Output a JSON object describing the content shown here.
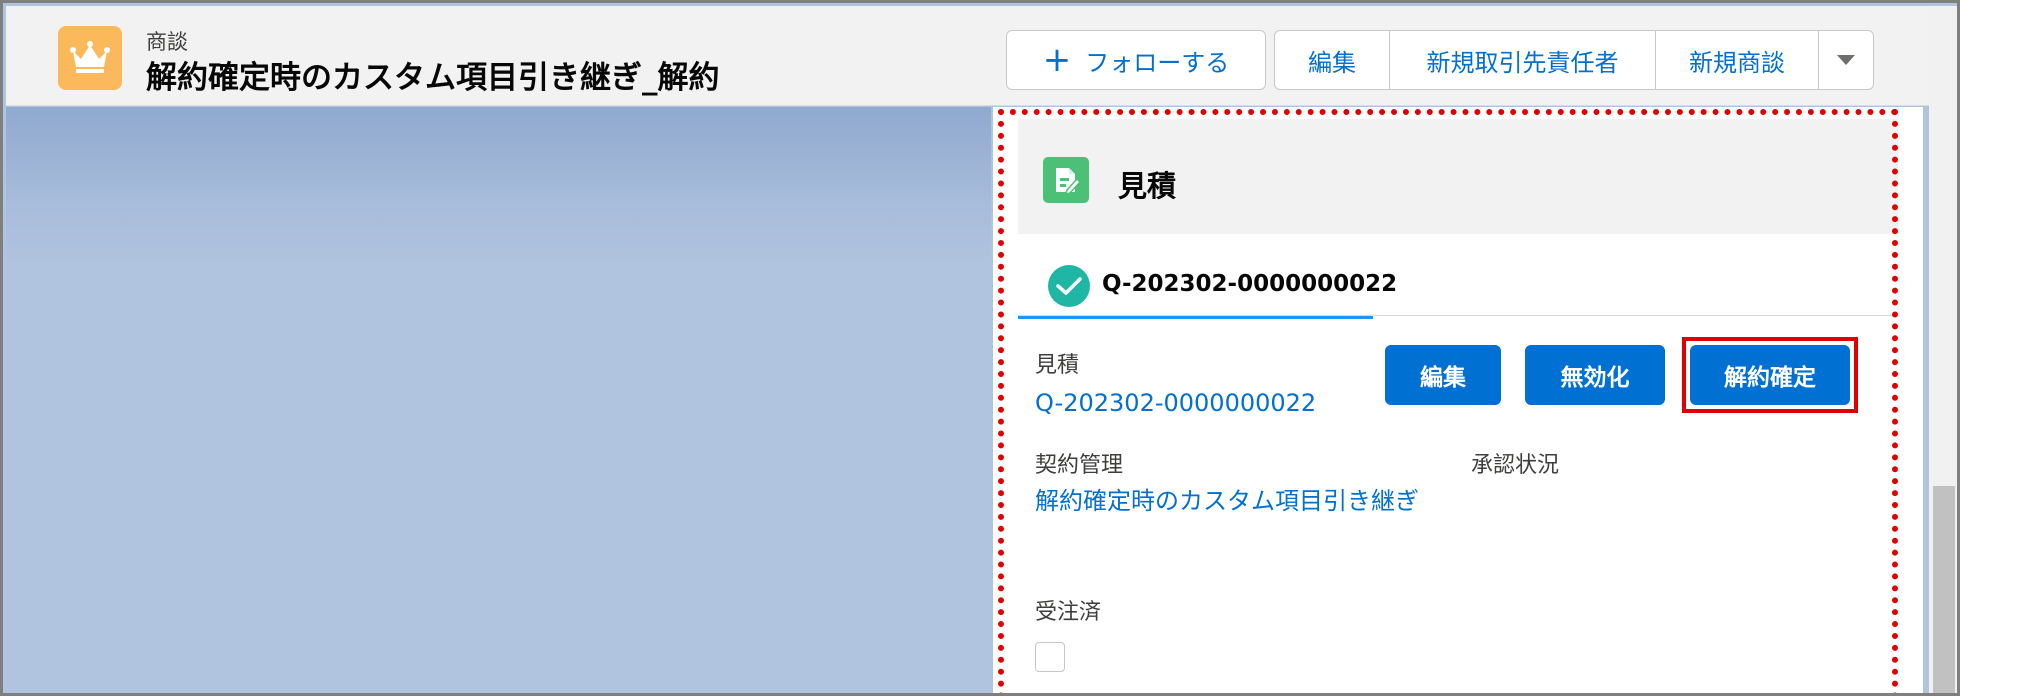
{
  "header": {
    "object_label": "商談",
    "record_title": "解約確定時のカスタム項目引き継ぎ_解約",
    "follow_label": "フォローする",
    "buttons": {
      "edit": "編集",
      "new_contact": "新規取引先責任者",
      "new_opportunity": "新規商談"
    }
  },
  "panel": {
    "title": "見積",
    "tab_label": "Q-202302-0000000022",
    "actions": {
      "edit": "編集",
      "invalidate": "無効化",
      "confirm_cancel": "解約確定"
    },
    "fields": {
      "quote_label": "見積",
      "quote_value": "Q-202302-0000000022",
      "contract_label": "契約管理",
      "contract_value": "解約確定時のカスタム項目引き継ぎ",
      "approval_label": "承認状況",
      "ordered_label": "受注済"
    }
  },
  "colors": {
    "brand": "#0070d2",
    "highlight": "#e00000",
    "app_icon": "#fcb95b",
    "quote_icon": "#4bc076",
    "check_icon": "#1fb6a6"
  }
}
